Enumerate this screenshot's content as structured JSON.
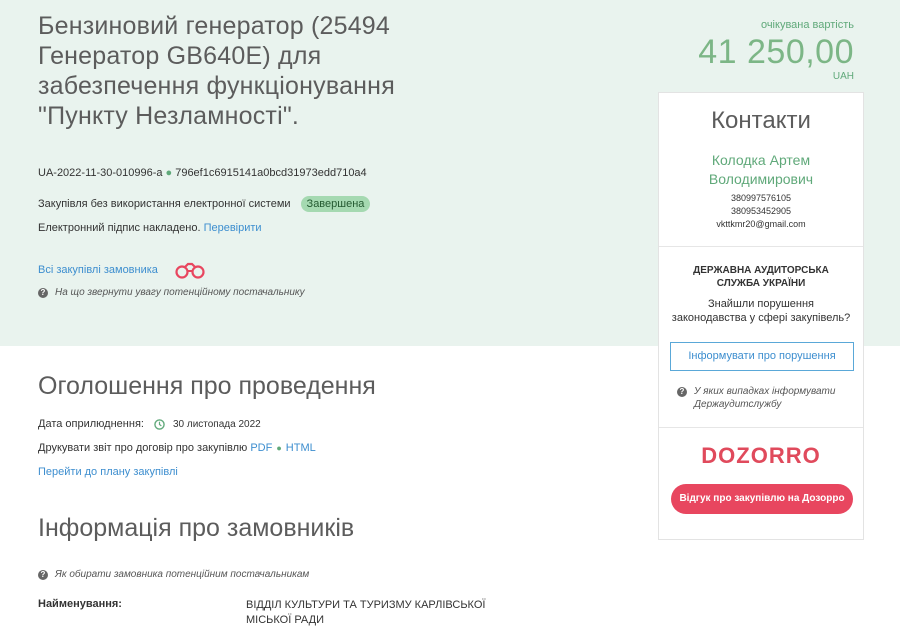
{
  "header": {
    "title": "Бензиновий генератор (25494 Генератор GB640E) для забезпечення функціонування \"Пункту Незламності\".",
    "tender_id": "UA-2022-11-30-010996-a",
    "tender_hash": "796ef1c6915141a0bcd31973edd710a4",
    "procurement_type": "Закупівля без використання електронної системи",
    "status_badge": "Завершена",
    "signature_text": "Електронний підпис накладено.",
    "signature_link": "Перевірити",
    "all_purchases_link": "Всі закупівлі замовника",
    "supplier_note": "На що звернути увагу потенційному постачальнику"
  },
  "price": {
    "label": "очікувана вартість",
    "amount": "41 250,00",
    "currency": "UAH"
  },
  "contacts": {
    "title": "Контакти",
    "name_line1": "Колодка Артем",
    "name_line2": "Володимирович",
    "phone1": "380997576105",
    "phone2": "380953452905",
    "email": "vkttkmr20@gmail.com"
  },
  "audit": {
    "title_line1": "ДЕРЖАВНА АУДИТОРСЬКА",
    "title_line2": "СЛУЖБА УКРАЇНИ",
    "text_line1": "Знайшли порушення",
    "text_line2": "законодавства у сфері закупівель?",
    "report_button": "Інформувати про порушення",
    "note_line1": "У яких випадках інформувати",
    "note_line2": "Держаудитслужбу"
  },
  "dozorro": {
    "logo_text": "DOZORRO",
    "button": "Відгук про закупівлю на Дозорро"
  },
  "announcement": {
    "title": "Оголошення про проведення",
    "date_label": "Дата оприлюднення:",
    "date_value": "30 листопада 2022",
    "print_label": "Друкувати звіт про договір про закупівлю",
    "pdf_link": "PDF",
    "html_link": "HTML",
    "plan_link": "Перейти до плану закупівлі"
  },
  "customers": {
    "title": "Інформація про замовників",
    "note": "Як обирати замовника потенційним постачальникам",
    "name_label": "Найменування:",
    "name_value": "ВІДДІЛ КУЛЬТУРИ ТА ТУРИЗМУ КАРЛІВСЬКОЇ МІСЬКОЇ РАДИ"
  },
  "colors": {
    "hero_bg": "#e9f3ee",
    "accent_green": "#60a97a",
    "link_blue": "#3d8ecf",
    "dozorro_red": "#e8465f"
  },
  "icons": [
    "binoculars-icon",
    "question-icon",
    "clock-icon"
  ]
}
